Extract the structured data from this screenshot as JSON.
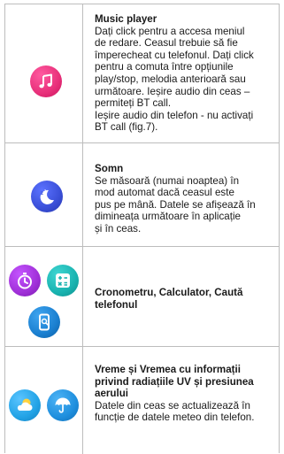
{
  "rows": [
    {
      "icon": "music-note-icon",
      "title": "Music player",
      "body": "Dați click pentru a accesa meniul\nde redare. Ceasul trebuie să fie\nîmperecheat cu telefonul. Dați click\npentru a comuta între opțiunile\nplay/stop, melodia anterioară sau\nurmătoare. Ieșire audio din ceas –\npermiteți BT call.\nIeșire audio din telefon - nu activați\nBT call (fig.7)."
    },
    {
      "icon": "sleep-moon-icon",
      "title": "Somn",
      "body": "Se măsoară (numai noaptea) în\nmod automat dacă ceasul este\npus pe mână. Datele se afișează în\ndimineața următoare în aplicație\nși în ceas."
    },
    {
      "icons": [
        "stopwatch-icon",
        "calculator-icon",
        "find-phone-icon"
      ],
      "title": "Cronometru, Calculator, Caută\ntelefonul"
    },
    {
      "icons": [
        "weather-icon",
        "umbrella-icon"
      ],
      "title": "Vreme și Vremea cu informații\nprivind radiațiile UV și presiunea\naerului",
      "body": "Datele din ceas se actualizează în\nfuncție de datele meteo din telefon."
    }
  ],
  "colors": {
    "music": "#e8307a",
    "sleep": "#3a4fd8",
    "stopwatch": "#a030d8",
    "calculator": "#19b3b0",
    "find_phone": "#1a7fd0",
    "weather": "#22a3e6",
    "umbrella": "#1f8fde"
  }
}
